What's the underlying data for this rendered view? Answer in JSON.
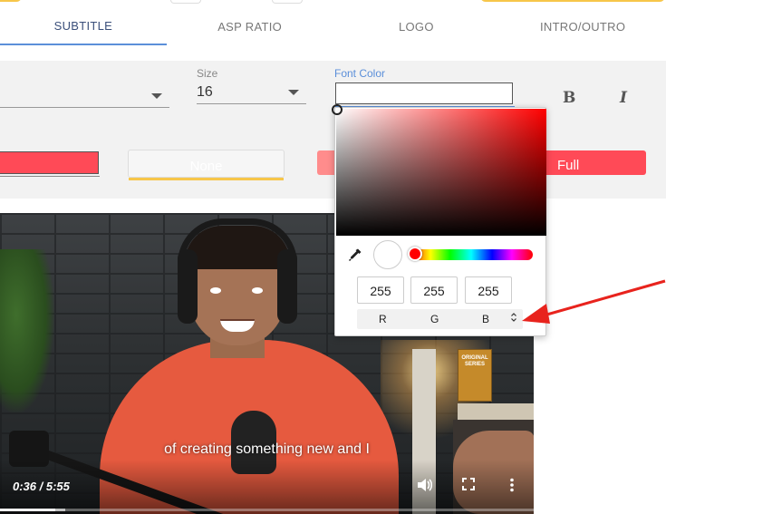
{
  "tabs": [
    {
      "label": "SUBTITLE",
      "active": true
    },
    {
      "label": "ASP RATIO",
      "active": false
    },
    {
      "label": "LOGO",
      "active": false
    },
    {
      "label": "INTRO/OUTRO",
      "active": false
    }
  ],
  "style_panel": {
    "size_label": "Size",
    "size_value": "16",
    "font_color_label": "Font Color",
    "font_color_value": "",
    "bold_label": "B",
    "italic_label": "I",
    "background_none_label": "None",
    "background_full_label": "Full"
  },
  "color_picker": {
    "rgb": {
      "r": "255",
      "g": "255",
      "b": "255"
    },
    "channel_labels": {
      "r": "R",
      "g": "G",
      "b": "B"
    },
    "mode_toggle_icon": "⌃⌄"
  },
  "video": {
    "caption": "of creating something new and I",
    "time": "0:36 / 5:55",
    "book_text": "ORIGINAL SERIES",
    "progress_fraction": 0.104
  },
  "colors": {
    "accent_blue": "#5b8fd9",
    "accent_yellow": "#f7c64a",
    "swatch_red": "#ff4a57",
    "annotation_arrow": "#e8231d"
  }
}
